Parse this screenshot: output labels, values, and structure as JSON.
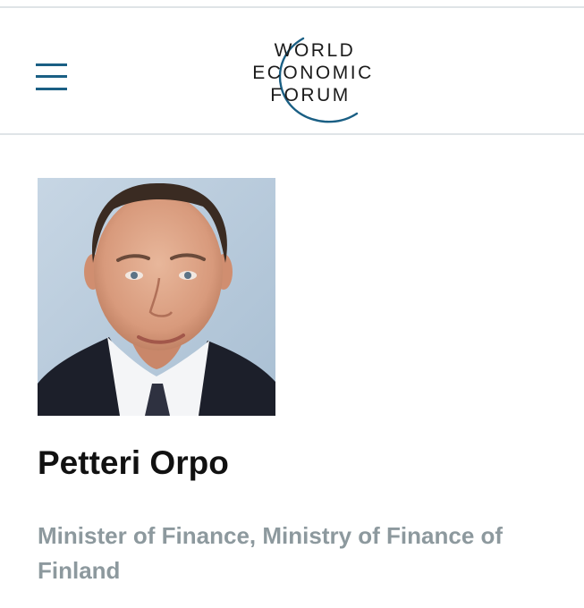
{
  "header": {
    "menu_icon": "hamburger-menu-icon",
    "brand_color": "#1a5f84",
    "logo": {
      "line1": "WORLD",
      "line2": "ECONOMIC",
      "line3": "FORUM"
    }
  },
  "profile": {
    "name": "Petteri Orpo",
    "title": "Minister of Finance, Ministry of Finance of Finland",
    "title_color": "#8d999e"
  }
}
